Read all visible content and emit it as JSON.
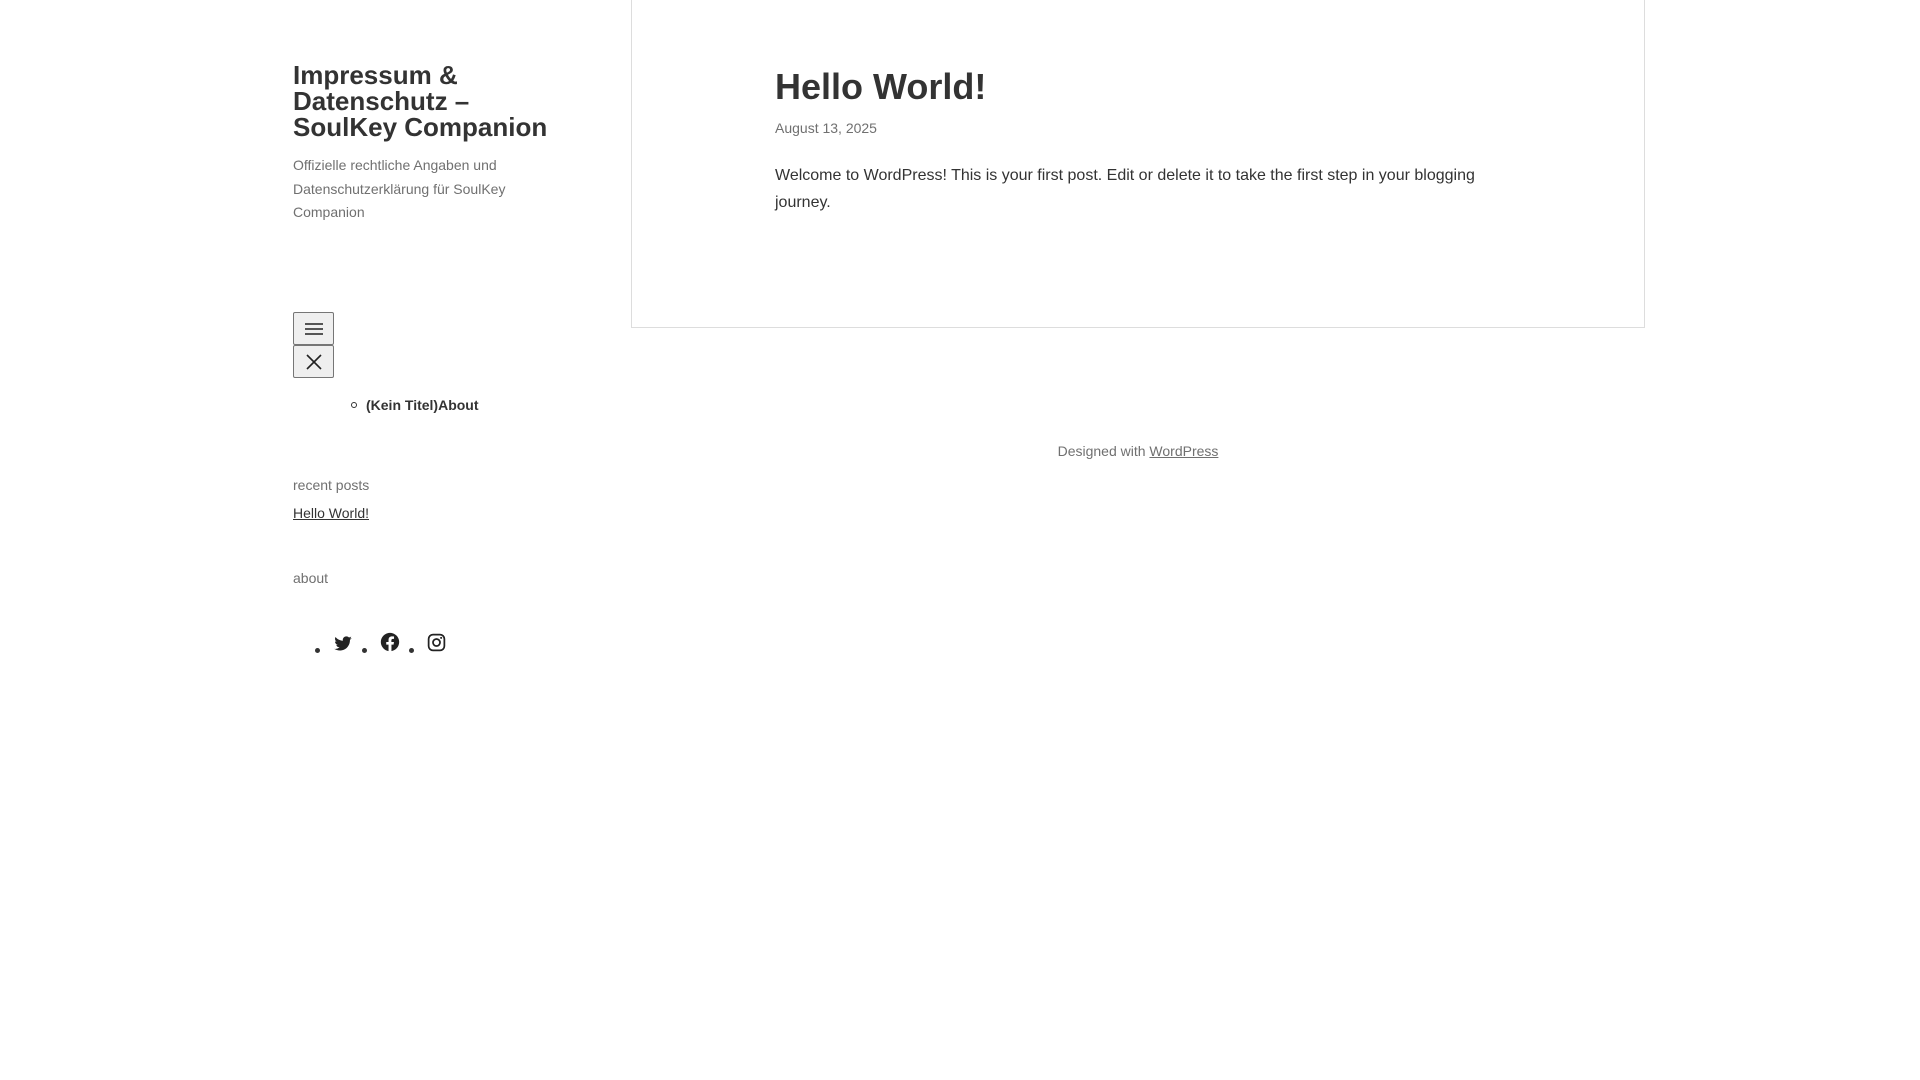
{
  "site": {
    "title": "Impressum & Datenschutz – SoulKey Companion",
    "description": "Offizielle rechtliche Angaben und Datenschutzerklärung für SoulKey Companion"
  },
  "nav": {
    "open_icon": "hamburger-menu-icon",
    "close_icon": "close-icon",
    "items": [
      {
        "label": "(Kein Titel)About"
      }
    ]
  },
  "widgets": {
    "recent_posts_title": "recent posts",
    "recent_posts": [
      {
        "label": "Hello World!"
      }
    ],
    "about_title": "about",
    "social_icons": [
      "twitter-icon",
      "facebook-icon",
      "instagram-icon"
    ]
  },
  "post": {
    "title": "Hello World!",
    "date": "August 13, 2025",
    "content": "Welcome to WordPress! This is your first post. Edit or delete it to take the first step in your blogging journey."
  },
  "footer": {
    "prefix": "Designed with",
    "link_label": "WordPress"
  }
}
